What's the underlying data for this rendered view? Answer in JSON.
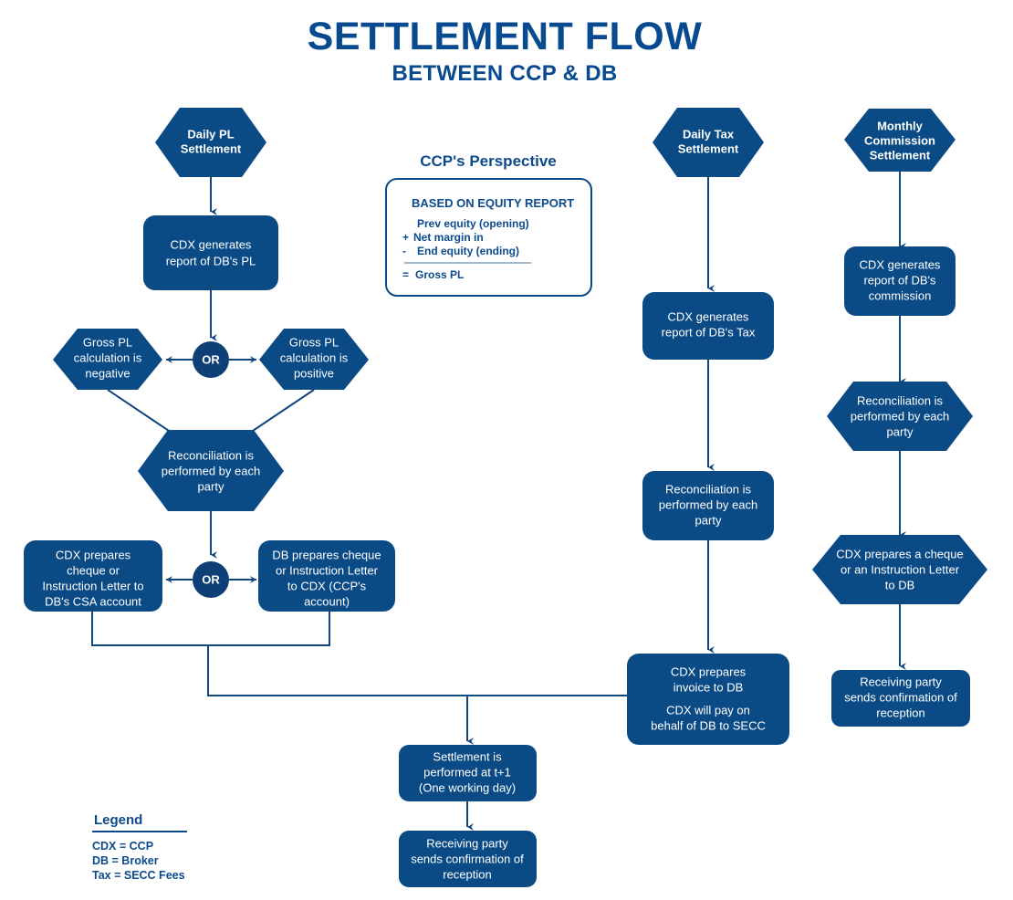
{
  "header": {
    "title": "SETTLEMENT FLOW",
    "subtitle": "BETWEEN CCP & DB"
  },
  "perspective_panel": {
    "title": "CCP's Perspective",
    "heading": "BASED ON EQUITY REPORT",
    "lines": [
      {
        "op": "",
        "text": "Prev equity (opening)"
      },
      {
        "op": "+",
        "text": "Net margin in"
      },
      {
        "op": "-",
        "text": "End equity (ending)"
      }
    ],
    "result_op": "=",
    "result_text": "Gross PL"
  },
  "legend": {
    "title": "Legend",
    "entries": [
      "CDX = CCP",
      "DB = Broker",
      "Tax = SECC Fees"
    ]
  },
  "columns": {
    "daily_pl": {
      "start_node": "Daily PL Settlement",
      "start_lines": [
        "Daily PL",
        "Settlement"
      ],
      "report_lines": [
        "CDX generates",
        "report of DB's PL"
      ],
      "or_label_1": "OR",
      "negative_lines": [
        "Gross PL",
        "calculation is",
        "negative"
      ],
      "positive_lines": [
        "Gross PL",
        "calculation is",
        "positive"
      ],
      "reconciliation_lines": [
        "Reconciliation is",
        "performed by each",
        "party"
      ],
      "or_label_2": "OR",
      "cdx_cheque_lines": [
        "CDX prepares",
        "cheque or",
        "Instruction Letter to",
        "DB's CSA account"
      ],
      "db_cheque_lines": [
        "DB prepares cheque",
        "or Instruction Letter",
        "to CDX (CCP's",
        "account)"
      ]
    },
    "daily_tax": {
      "start_lines": [
        "Daily Tax",
        "Settlement"
      ],
      "report_lines": [
        "CDX generates",
        "report of DB's Tax"
      ],
      "reconciliation_lines": [
        "Reconciliation is",
        "performed by each",
        "party"
      ],
      "invoice_lines": [
        "CDX prepares",
        "invoice to DB",
        "",
        "CDX will pay on",
        "behalf of DB to SECC"
      ]
    },
    "monthly_commission": {
      "start_lines": [
        "Monthly",
        "Commission",
        "Settlement"
      ],
      "report_lines": [
        "CDX generates",
        "report of DB's",
        "commission"
      ],
      "reconciliation_lines": [
        "Reconciliation is",
        "performed by each",
        "party"
      ],
      "cheque_lines": [
        "CDX prepares a cheque",
        "or an Instruction Letter",
        "to DB"
      ],
      "confirmation_lines": [
        "Receiving party",
        "sends confirmation of",
        "reception"
      ]
    },
    "shared_bottom": {
      "settlement_lines": [
        "Settlement is",
        "performed at t+1",
        "(One working day)"
      ],
      "confirmation_lines": [
        "Receiving party",
        "sends confirmation of",
        "reception"
      ]
    }
  },
  "colors": {
    "node_fill": "#0a4a85",
    "connector": "#12467f",
    "title": "#084a8f",
    "panel_stroke": "#0d4a8c",
    "node_text": "#ffffff"
  }
}
